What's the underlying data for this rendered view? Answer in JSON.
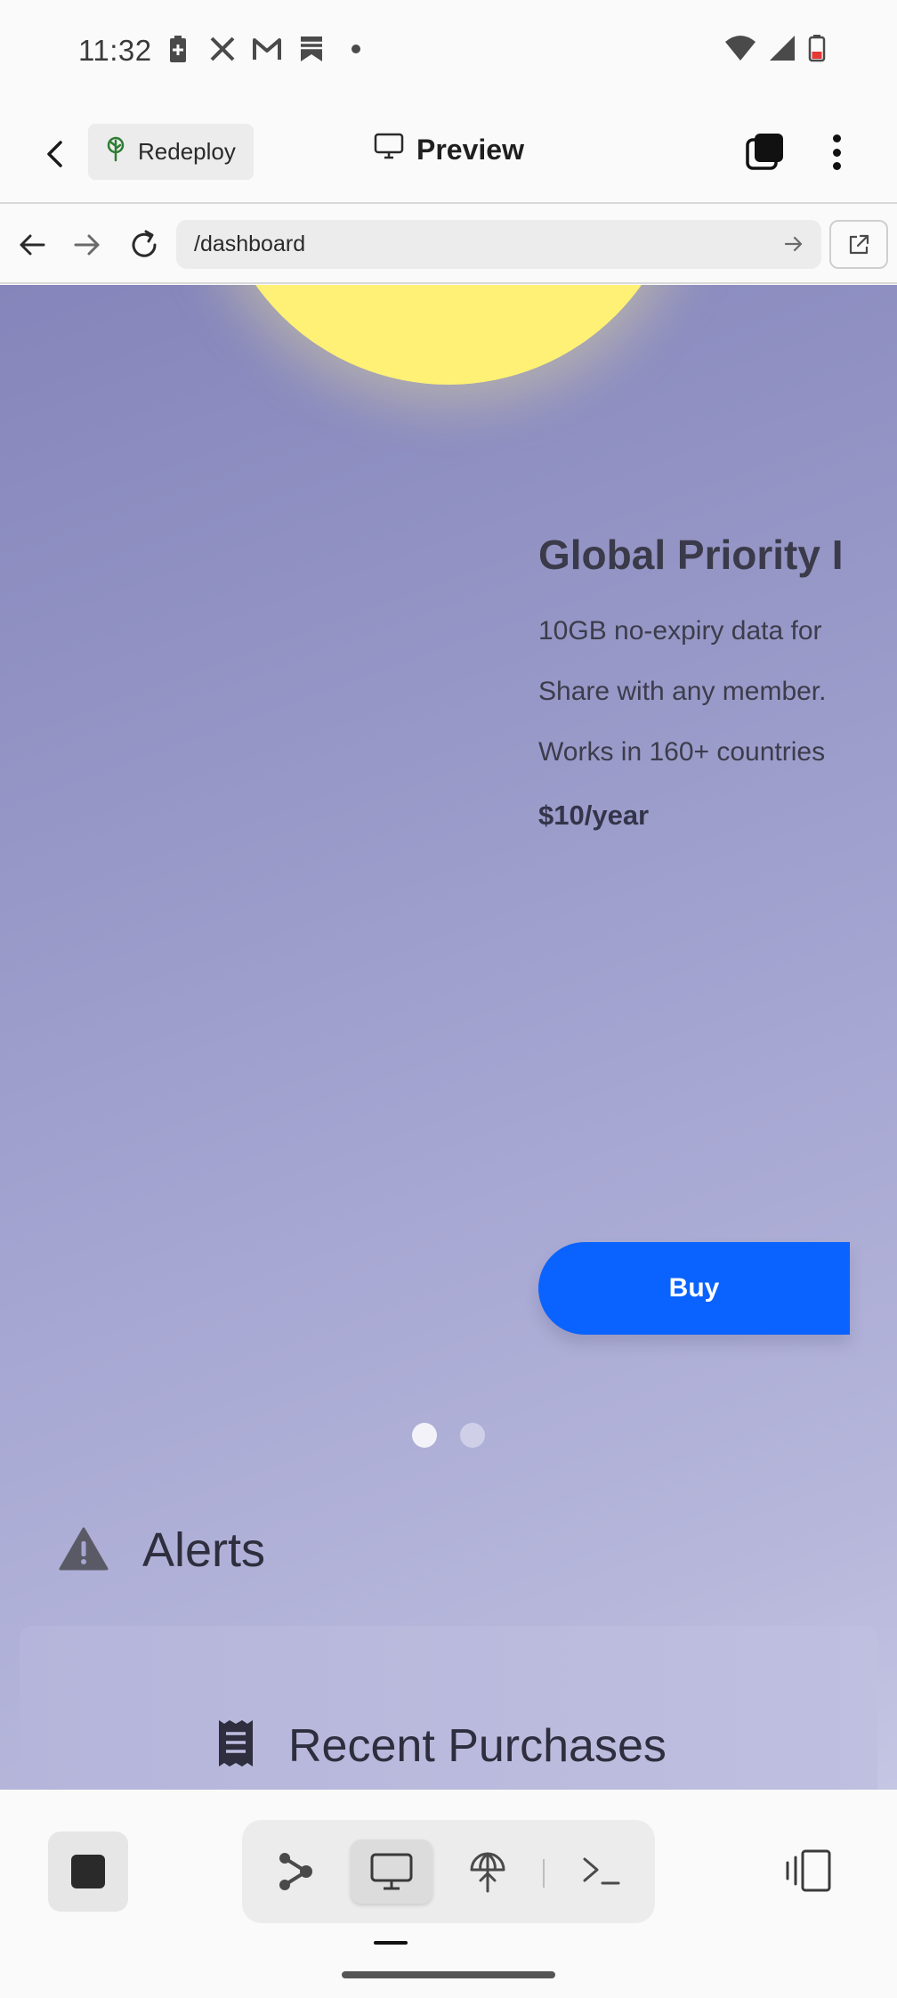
{
  "status_bar": {
    "time": "11:32",
    "left_icons": [
      "battery-saver-icon",
      "x-app-icon",
      "gmail-icon",
      "bookmark-app-icon",
      "notification-dot-icon"
    ],
    "right_icons": [
      "wifi-icon",
      "signal-icon",
      "battery-low-icon"
    ],
    "battery_color": "#e53935"
  },
  "app_bar": {
    "redeploy_label": "Redeploy",
    "preview_label": "Preview"
  },
  "browser": {
    "url": "/dashboard"
  },
  "carousel": {
    "card": {
      "title": "Global Priority I",
      "lines": [
        "10GB no-expiry data for",
        "Share with any member.",
        "Works in 160+ countries"
      ],
      "price": "$10/year",
      "buy_label": "Buy"
    },
    "pages": 2,
    "active_page": 1
  },
  "sections": {
    "alerts_label": "Alerts",
    "recent_purchases_label": "Recent Purchases"
  },
  "colors": {
    "accent": "#0a63ff",
    "sun": "#fff176",
    "background_start": "#8585bb",
    "background_end": "#c5c6e4"
  }
}
